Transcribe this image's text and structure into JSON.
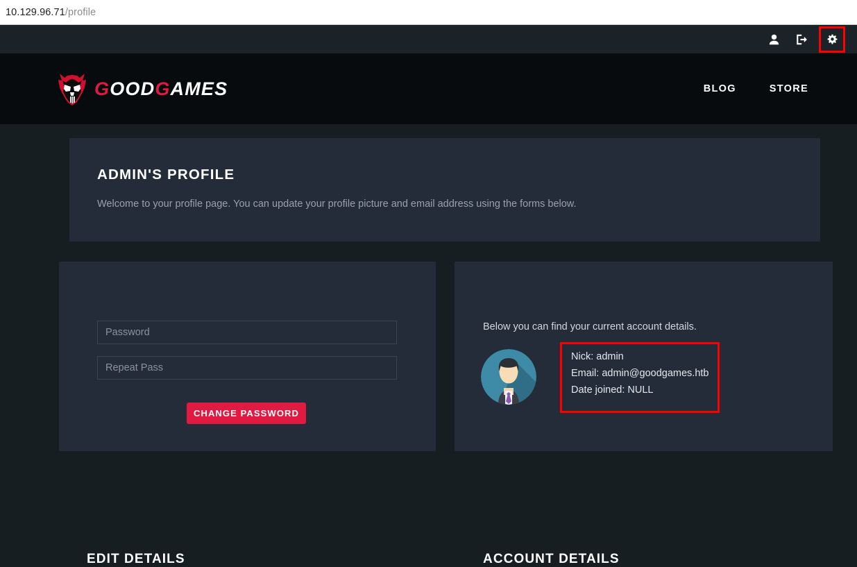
{
  "browser": {
    "url_host": "10.129.96.71",
    "url_path": "/profile"
  },
  "topbar": {
    "icons": [
      {
        "name": "user-icon",
        "label": "Account"
      },
      {
        "name": "logout-icon",
        "label": "Log out"
      },
      {
        "name": "gear-icon",
        "label": "Settings"
      }
    ]
  },
  "nav": {
    "brand": {
      "text_part1": "G",
      "text_part2": "OOD",
      "text_part3": "G",
      "text_part4": "AMES",
      "mark": "demon-skull-icon"
    },
    "links": [
      {
        "label": "BLOG"
      },
      {
        "label": "STORE"
      }
    ]
  },
  "banner": {
    "title": "ADMIN'S PROFILE",
    "subtitle": "Welcome to your profile page. You can update your profile picture and email address using the forms below."
  },
  "edit_details": {
    "title": "EDIT DETAILS",
    "password_placeholder": "Password",
    "password_value": "",
    "repeat_placeholder": "Repeat Pass",
    "repeat_value": "",
    "submit_label": "CHANGE PASSWORD"
  },
  "account_details": {
    "title": "ACCOUNT DETAILS",
    "subtitle": "Below you can find your current account details.",
    "avatar": "user-avatar-image",
    "nick": "Nick: admin",
    "email": "Email: admin@goodgames.htb",
    "date_joined": "Date joined: NULL"
  },
  "colors": {
    "page_background": "#161e22",
    "nav_background": "#080b0e",
    "topbar_background": "#1b2328",
    "card_background": "#252c39",
    "accent_red": "#e01a40",
    "highlight_red": "#ff0000",
    "muted_text": "#9aa1ab"
  }
}
